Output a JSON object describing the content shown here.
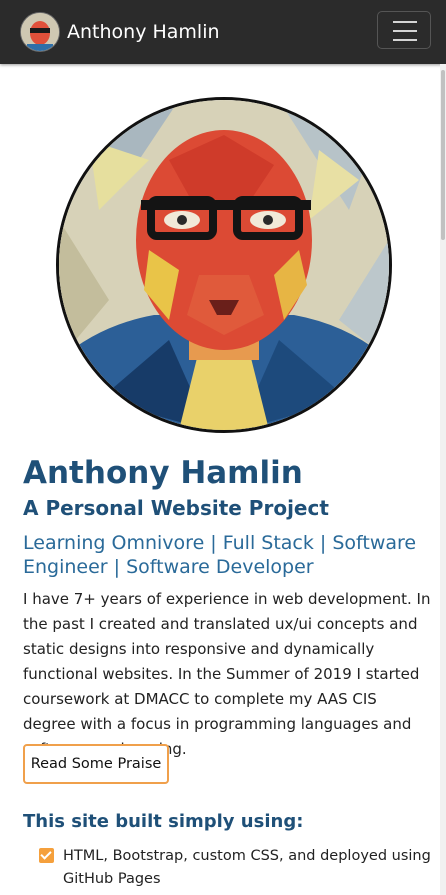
{
  "navbar": {
    "brand_name": "Anthony Hamlin",
    "toggler_icon": "hamburger-menu-icon",
    "background": "#2b2b2b"
  },
  "hero": {
    "name": "Anthony Hamlin",
    "subtitle": "A Personal Website Project",
    "roles": "Learning Omnivore | Full Stack | Software Engineer | Software Developer",
    "bio": "I have 7+ years of experience in web development. In the past I created and translated ux/ui concepts and static designs into responsive and dynamically functional websites. In the Summer of 2019 I started coursework at DMACC to complete my AAS CIS degree with a focus in programming languages and software engineering.",
    "praise_button": "Read Some Praise"
  },
  "built_with": {
    "title": "This site built simply using:",
    "items": [
      "HTML, Bootstrap, custom CSS, and deployed using GitHub Pages"
    ]
  },
  "colors": {
    "heading": "#1f5078",
    "roles": "#2a6a99",
    "accent": "#f0a04b"
  }
}
